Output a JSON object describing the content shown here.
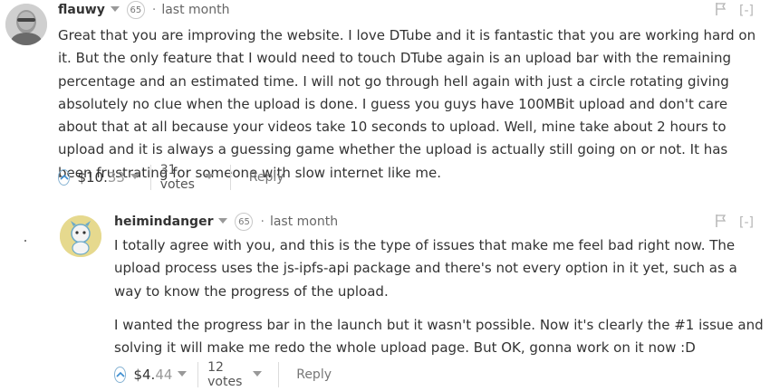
{
  "comments": [
    {
      "author": "flauwy",
      "reputation": "65",
      "separator": "·",
      "time": "last month",
      "collapse": "[-]",
      "paragraphs": [
        "Great that you are improving the website. I love DTube and it is fantastic that you are working hard on it. But the only feature that I would need to touch DTube again is an upload bar with the remaining percentage and an estimated time. I will not go through hell again with just a circle rotating giving absolutely no clue when the upload is done. I guess you guys have 100MBit upload and don't care about that at all because your videos take 10 seconds to upload. Well, mine take about 2 hours to upload and it is always a guessing game whether the upload is actually still going on or not. It has been frustrating for someone with slow internet like me."
      ],
      "payout_main": "$10.",
      "payout_cents": "33",
      "votes": "31 votes",
      "reply": "Reply",
      "icons": {
        "flag": "flag-icon",
        "upvote": "upvote-icon",
        "dropdown": "caret-down-icon"
      }
    },
    {
      "author": "heimindanger",
      "reputation": "65",
      "separator": "·",
      "time": "last month",
      "collapse": "[-]",
      "paragraphs": [
        "I totally agree with you, and this is the type of issues that make me feel bad right now. The upload process uses the js-ipfs-api package and there's not every option in it yet, such as a way to know the progress of the upload.",
        "I wanted the progress bar in the launch but it wasn't possible. Now it's clearly the #1 issue and solving it will make me redo the whole upload page. But OK, gonna work on it now :D"
      ],
      "payout_main": "$4.",
      "payout_cents": "44",
      "votes": "12 votes",
      "reply": "Reply",
      "icons": {
        "flag": "flag-icon",
        "upvote": "upvote-icon",
        "dropdown": "caret-down-icon"
      }
    }
  ],
  "colors": {
    "upvote": "#3b8dd1",
    "muted": "#999999",
    "text": "#333333"
  }
}
